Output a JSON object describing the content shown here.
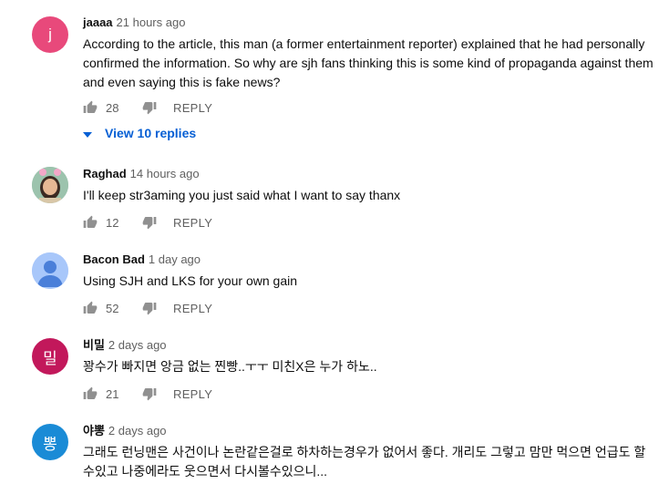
{
  "comments": [
    {
      "author": "jaaaa",
      "time": "21 hours ago",
      "avatar_letter": "j",
      "avatar_color": "#e8497b",
      "text": "According to the article, this man (a former entertainment reporter) explained that he had personally confirmed the information. So why are sjh fans thinking this is some kind of propaganda against them and even saying this is fake news?",
      "likes": "28",
      "reply_label": "REPLY",
      "view_replies": "View 10 replies"
    },
    {
      "author": "Raghad",
      "time": "14 hours ago",
      "avatar_letter": "",
      "avatar_color": "#8fb7a2",
      "text": "I'll keep str3aming you just said what I want to say thanx",
      "likes": "12",
      "reply_label": "REPLY"
    },
    {
      "author": "Bacon Bad",
      "time": "1 day ago",
      "avatar_letter": "",
      "avatar_color": "#a8c7fa",
      "text": "Using SJH and LKS for your own gain",
      "likes": "52",
      "reply_label": "REPLY"
    },
    {
      "author": "비밀",
      "time": "2 days ago",
      "avatar_letter": "밀",
      "avatar_color": "#c2185b",
      "text": "꽝수가 빠지면 앙금 없는 찐빵..ㅜㅜ 미친X은 누가 하노..",
      "likes": "21",
      "reply_label": "REPLY"
    },
    {
      "author": "야뽕",
      "time": "2 days ago",
      "avatar_letter": "뽕",
      "avatar_color": "#1a8bd6",
      "text": "그래도 런닝맨은 사건이나 논란같은걸로 하차하는경우가 없어서 좋다. 개리도 그렇고 맘만 먹으면 언급도 할수있고 나중에라도 웃으면서 다시볼수있으니...",
      "likes": "",
      "reply_label": ""
    }
  ]
}
